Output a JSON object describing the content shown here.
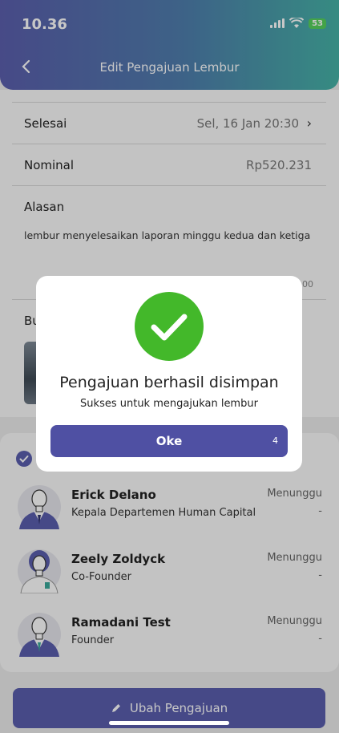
{
  "status_bar": {
    "time": "10.36",
    "battery": "53"
  },
  "header": {
    "title": "Edit  Pengajuan Lembur"
  },
  "form": {
    "selesai_label": "Selesai",
    "selesai_value": "Sel, 16 Jan 20:30",
    "nominal_label": "Nominal",
    "nominal_value": "Rp520.231",
    "alasan_label": "Alasan",
    "alasan_text": "lembur menyelesaikan laporan minggu kedua dan ketiga",
    "char_count_partial": "00",
    "bukti_label_partial": "Bu"
  },
  "approvers": [
    {
      "name": "Erick Delano",
      "role": "Kepala Departemen Human Capital",
      "status": "Menunggu",
      "date": "-"
    },
    {
      "name": "Zeely Zoldyck",
      "role": "Co-Founder",
      "status": "Menunggu",
      "date": "-"
    },
    {
      "name": "Ramadani Test",
      "role": "Founder",
      "status": "Menunggu",
      "date": "-"
    }
  ],
  "bottom_button": {
    "label": "Ubah Pengajuan"
  },
  "dialog": {
    "title": "Pengajuan berhasil disimpan",
    "subtitle": "Sukses untuk mengajukan lembur",
    "button_label": "Oke",
    "countdown": "4"
  },
  "colors": {
    "header_gradient": [
      "#5b5fae",
      "#46b3a7"
    ],
    "primary": "#4f50a3",
    "success": "#43b82a"
  }
}
